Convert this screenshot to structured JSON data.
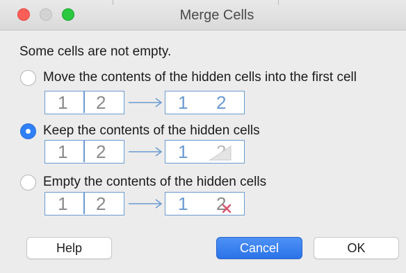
{
  "window": {
    "title": "Merge Cells"
  },
  "dialog": {
    "heading": "Some cells are not empty.",
    "options": [
      {
        "label": "Move the contents of the hidden cells into the first cell",
        "selected": false,
        "example": {
          "left_cells": [
            "1",
            "2"
          ],
          "right_cells": [
            "1",
            "2"
          ],
          "right_style": "moved"
        }
      },
      {
        "label": "Keep the contents of the hidden cells",
        "selected": true,
        "example": {
          "left_cells": [
            "1",
            "2"
          ],
          "right_cells": [
            "1",
            "2"
          ],
          "right_style": "hidden"
        }
      },
      {
        "label": "Empty the contents of the hidden cells",
        "selected": false,
        "example": {
          "left_cells": [
            "1",
            "2"
          ],
          "right_cells": [
            "1",
            "2"
          ],
          "right_style": "deleted"
        }
      }
    ]
  },
  "buttons": {
    "help": "Help",
    "cancel": "Cancel",
    "ok": "OK"
  },
  "colors": {
    "accent": "#2f7ff6",
    "cell_border": "#6a9ad1",
    "digit": "#8a8a8a",
    "delete_mark": "#d9546e"
  }
}
